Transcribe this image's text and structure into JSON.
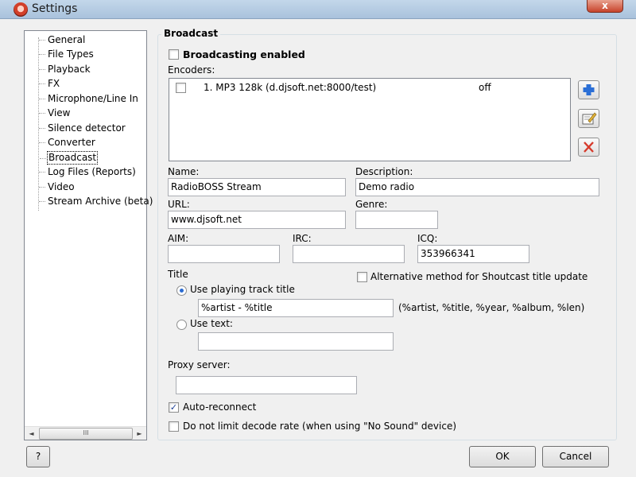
{
  "window": {
    "title": "Settings",
    "close_label": "x"
  },
  "tree": {
    "items": [
      "General",
      "File Types",
      "Playback",
      "FX",
      "Microphone/Line In",
      "View",
      "Silence detector",
      "Converter",
      "Broadcast",
      "Log Files (Reports)",
      "Video",
      "Stream Archive (beta)"
    ],
    "selected": "Broadcast",
    "scroll_left": "◄",
    "scroll_right": "►",
    "scroll_thumb": "III"
  },
  "broadcast": {
    "group_title": "Broadcast",
    "enabled_label": "Broadcasting enabled",
    "enabled_checked": false,
    "encoders_label": "Encoders:",
    "encoders": [
      {
        "name": "1. MP3 128k (d.djsoft.net:8000/test)",
        "status": "off",
        "checked": false
      }
    ],
    "name_label": "Name:",
    "name_value": "RadioBOSS Stream",
    "description_label": "Description:",
    "description_value": "Demo radio",
    "url_label": "URL:",
    "url_value": "www.djsoft.net",
    "genre_label": "Genre:",
    "genre_value": "",
    "aim_label": "AIM:",
    "aim_value": "",
    "irc_label": "IRC:",
    "irc_value": "",
    "icq_label": "ICQ:",
    "icq_value": "353966341",
    "title_section_label": "Title",
    "use_track_title_label": "Use playing track title",
    "use_track_title_selected": true,
    "track_title_value": "%artist - %title",
    "macros_hint": "(%artist, %title, %year, %album, %len)",
    "use_text_label": "Use text:",
    "use_text_selected": false,
    "use_text_value": "",
    "alt_method_label": "Alternative method for Shoutcast title update",
    "alt_method_checked": false,
    "proxy_label": "Proxy server:",
    "proxy_value": "",
    "auto_reconnect_label": "Auto-reconnect",
    "auto_reconnect_checked": true,
    "no_limit_label": "Do not limit decode rate (when using \"No Sound\" device)",
    "no_limit_checked": false
  },
  "buttons": {
    "help_label": "?",
    "ok_label": "OK",
    "cancel_label": "Cancel"
  },
  "icons": {
    "add": "plus-icon",
    "edit": "edit-icon",
    "delete": "delete-icon",
    "check_mark": "✓"
  },
  "colors": {
    "accent": "#2a6bd1",
    "add_icon": "#2b6fd6",
    "delete_icon": "#d63a2b",
    "titlebar": "#b6cce2"
  }
}
